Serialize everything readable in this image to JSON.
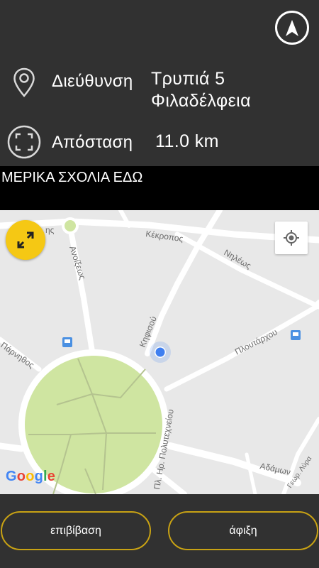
{
  "header": {
    "navigation_icon": "navigation-arrow-icon",
    "address_icon": "location-pin-icon",
    "distance_icon": "distance-frame-icon",
    "address_label": "Διεύθυνση",
    "address_line1": "Τρυπιά 5",
    "address_line2": "Φιλαδέλφεια",
    "distance_label": "Απόσταση",
    "distance_value": "11.0 km"
  },
  "comments": {
    "text": "ΜΕΡΙΚΑ ΣΧΟΛΙΑ ΕΔΩ"
  },
  "map": {
    "streets": {
      "kekropos": "Κέκροπος",
      "nileos": "Νηλέως",
      "anoixeos": "Ανοίξεως",
      "kifisou": "Κηφισού",
      "ploutarchou": "Πλουτάρχου",
      "parnithos": "Πάρνηθος",
      "polytechneiou": "Πλ. Ηρ. Πολυτεχνείου",
      "adamon": "Αδάμων",
      "georg_lyra": "Γεωρ. Λύρα",
      "partial_left": "ης"
    },
    "expand_icon": "expand-arrows-icon",
    "locate_icon": "my-location-icon",
    "bus_stop_icon": "bus-stop-icon",
    "google_logo": {
      "G": "G",
      "o1": "o",
      "o2": "o",
      "g": "g",
      "l": "l",
      "e": "e"
    },
    "colors": {
      "park": "#cfe5a1",
      "road": "#ffffff",
      "background": "#e8e8e8",
      "user_dot": "#3f7ff0"
    }
  },
  "footer": {
    "boarding_label": "επιβίβαση",
    "arrival_label": "άφιξη",
    "accent_color": "#c8a214"
  }
}
